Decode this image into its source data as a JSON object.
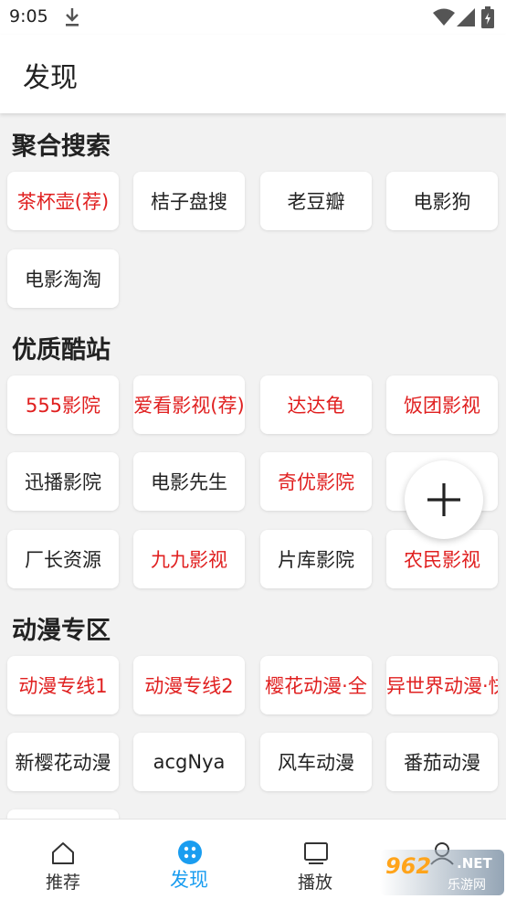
{
  "status_bar": {
    "time": "9:05",
    "icons": [
      "download-icon",
      "wifi-icon",
      "signal-icon",
      "battery-icon"
    ]
  },
  "header": {
    "title": "发现"
  },
  "sections": [
    {
      "title": "聚合搜索",
      "items": [
        {
          "label": "茶杯壶(荐)",
          "highlight": true
        },
        {
          "label": "桔子盘搜",
          "highlight": false
        },
        {
          "label": "老豆瓣",
          "highlight": false
        },
        {
          "label": "电影狗",
          "highlight": false
        },
        {
          "label": "电影淘淘",
          "highlight": false
        }
      ]
    },
    {
      "title": "优质酷站",
      "items": [
        {
          "label": "555影院",
          "highlight": true
        },
        {
          "label": "爱看影视(荐)",
          "highlight": true
        },
        {
          "label": "达达龟",
          "highlight": true
        },
        {
          "label": "饭团影视",
          "highlight": true
        },
        {
          "label": "迅播影院",
          "highlight": false
        },
        {
          "label": "电影先生",
          "highlight": false
        },
        {
          "label": "奇优影院",
          "highlight": true
        },
        {
          "label": "",
          "highlight": true
        },
        {
          "label": "厂长资源",
          "highlight": false
        },
        {
          "label": "九九影视",
          "highlight": true
        },
        {
          "label": "片库影院",
          "highlight": false
        },
        {
          "label": "农民影视",
          "highlight": true
        }
      ]
    },
    {
      "title": "动漫专区",
      "items": [
        {
          "label": "动漫专线1",
          "highlight": true
        },
        {
          "label": "动漫专线2",
          "highlight": true
        },
        {
          "label": "樱花动漫·全",
          "highlight": true
        },
        {
          "label": "异世界动漫·快",
          "highlight": true
        },
        {
          "label": "新樱花动漫",
          "highlight": false
        },
        {
          "label": "acgNya",
          "highlight": false
        },
        {
          "label": "风车动漫",
          "highlight": false
        },
        {
          "label": "番茄动漫",
          "highlight": false
        }
      ]
    }
  ],
  "fab": {
    "icon": "plus-icon"
  },
  "bottom_nav": {
    "items": [
      {
        "label": "推荐",
        "icon": "home-icon",
        "active": false
      },
      {
        "label": "发现",
        "icon": "discover-icon",
        "active": true
      },
      {
        "label": "播放",
        "icon": "tv-icon",
        "active": false
      },
      {
        "label": "",
        "icon": "profile-icon",
        "active": false
      }
    ]
  },
  "watermark": {
    "number": "962",
    "net": ".NET",
    "sub": "乐游网"
  },
  "colors": {
    "accent": "#1a9df0",
    "highlight_text": "#e02020",
    "background": "#f2f2f2"
  }
}
